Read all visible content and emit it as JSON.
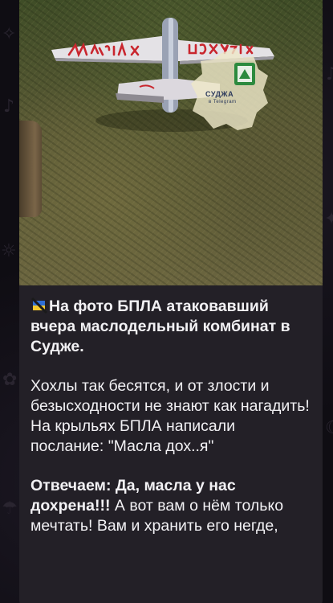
{
  "post": {
    "watermark": {
      "title": "СУДЖА",
      "subtitle": "в Telegram"
    },
    "drone_wing_text": "МАСЛА ДОХ..Я",
    "headline": "На фото БПЛА атаковавший вчера маслодельный комбинат в Судже.",
    "paragraph2": "Хохлы так бесятся, и от злости и безысходности не знают как нагадить! На крыльях БПЛА написали послание: \"Масла дох..я\"",
    "paragraph3_bold": "Отвечаем:  Да, масла у нас дохрена!!!",
    "paragraph3_rest": " А вот вам о нём только мечтать! Вам и хранить его негде,"
  },
  "colors": {
    "bubble": "#232027",
    "text": "#f2f1f4",
    "background": "#0f0d13"
  }
}
